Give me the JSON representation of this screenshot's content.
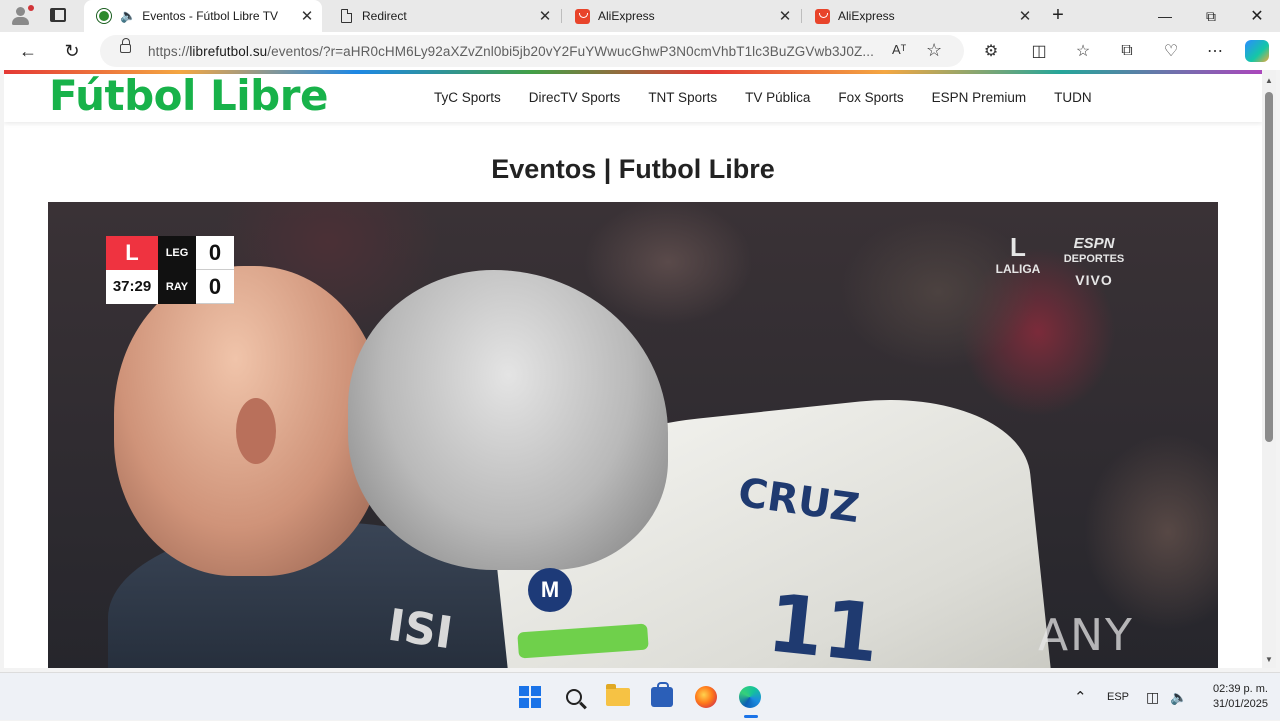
{
  "browser": {
    "tabs": [
      {
        "title": "Eventos - Fútbol Libre TV",
        "icon": "soccer-ball-icon",
        "active": true,
        "audio": true
      },
      {
        "title": "Redirect",
        "icon": "document-icon",
        "active": false
      },
      {
        "title": "AliExpress",
        "icon": "aliexpress-icon",
        "active": false
      },
      {
        "title": "AliExpress",
        "icon": "aliexpress-icon",
        "active": false
      }
    ],
    "url_prefix": "https://",
    "url_host": "librefutbol.su",
    "url_path": "/eventos/?r=aHR0cHM6Ly92aXZvZnl0bi5jb20vY2FuYWwucGhwP3N0cmVhbT1lc3BuZGVwb3J0Z...",
    "read_aloud": "Aᵀ"
  },
  "site": {
    "logo": "Fútbol Libre",
    "menu": [
      "TyC Sports",
      "DirecTV Sports",
      "TNT Sports",
      "TV Pública",
      "Fox Sports",
      "ESPN Premium",
      "TUDN"
    ],
    "page_title": "Eventos | Futbol Libre"
  },
  "video": {
    "scorebug": {
      "league_logo": "L",
      "clock": "37:29",
      "team_home": "LEG",
      "team_away": "RAY",
      "score_home": "0",
      "score_away": "0"
    },
    "league_text": "LALIGA",
    "broadcaster_line1": "ESPN",
    "broadcaster_line2": "DEPORTES",
    "live_text": "VIVO",
    "jersey_front": "ISI",
    "jersey_back_name": "CRUZ",
    "jersey_back_number": "11",
    "sponsor_letter": "M",
    "watermark": "ANY RUN"
  },
  "taskbar": {
    "language": "ESP",
    "time": "02:39 p. m.",
    "date": "31/01/2025"
  },
  "colors": {
    "logo_green": "#18b24a",
    "laliga_red": "#ef3340",
    "taskbar_accent": "#1a73e8"
  }
}
